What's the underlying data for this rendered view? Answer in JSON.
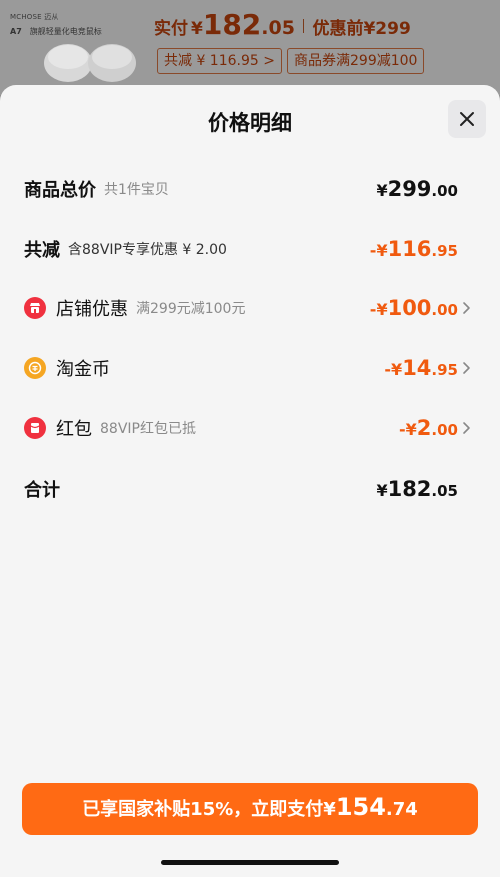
{
  "background": {
    "brand": "MCHOSE 迈从",
    "model": "A7",
    "product_name": "旗舰轻量化电竞鼠标",
    "price_label": "实付",
    "price_currency": "¥",
    "price_int": "182",
    "price_dec": ".05",
    "pre_label": "优惠前",
    "pre_price": "¥299",
    "tag_reduce": "共减 ¥ 116.95 >",
    "tag_coupon": "商品券满299减100"
  },
  "sheet": {
    "title": "价格明细",
    "rows": [
      {
        "label": "商品总价",
        "sub": "共1件宝贝",
        "sign": "¥",
        "int": "299",
        "dec": ".00"
      },
      {
        "label": "共减",
        "sub": "含88VIP专享优惠 ¥ 2.00",
        "sign": "-¥",
        "int": "116",
        "dec": ".95"
      },
      {
        "label": "店铺优惠",
        "sub": "满299元减100元",
        "sign": "-¥",
        "int": "100",
        "dec": ".00"
      },
      {
        "label": "淘金币",
        "sub": "",
        "sign": "-¥",
        "int": "14",
        "dec": ".95"
      },
      {
        "label": "红包",
        "sub": "88VIP红包已抵",
        "sign": "-¥",
        "int": "2",
        "dec": ".00"
      },
      {
        "label": "合计",
        "sub": "",
        "sign": "¥",
        "int": "182",
        "dec": ".05"
      }
    ],
    "pay_button": {
      "text": "已享国家补贴15%，立即支付",
      "sign": "¥",
      "int": "154",
      "dec": ".74"
    }
  },
  "colors": {
    "accent": "#ff6a14",
    "discount_text": "#f05a0f",
    "shop_icon": "#f0313f",
    "coin_icon": "#f5a623",
    "redpacket_icon": "#f0313f"
  },
  "icons": [
    "close-icon",
    "shop-icon",
    "coin-icon",
    "red-packet-icon",
    "chevron-right-icon"
  ]
}
